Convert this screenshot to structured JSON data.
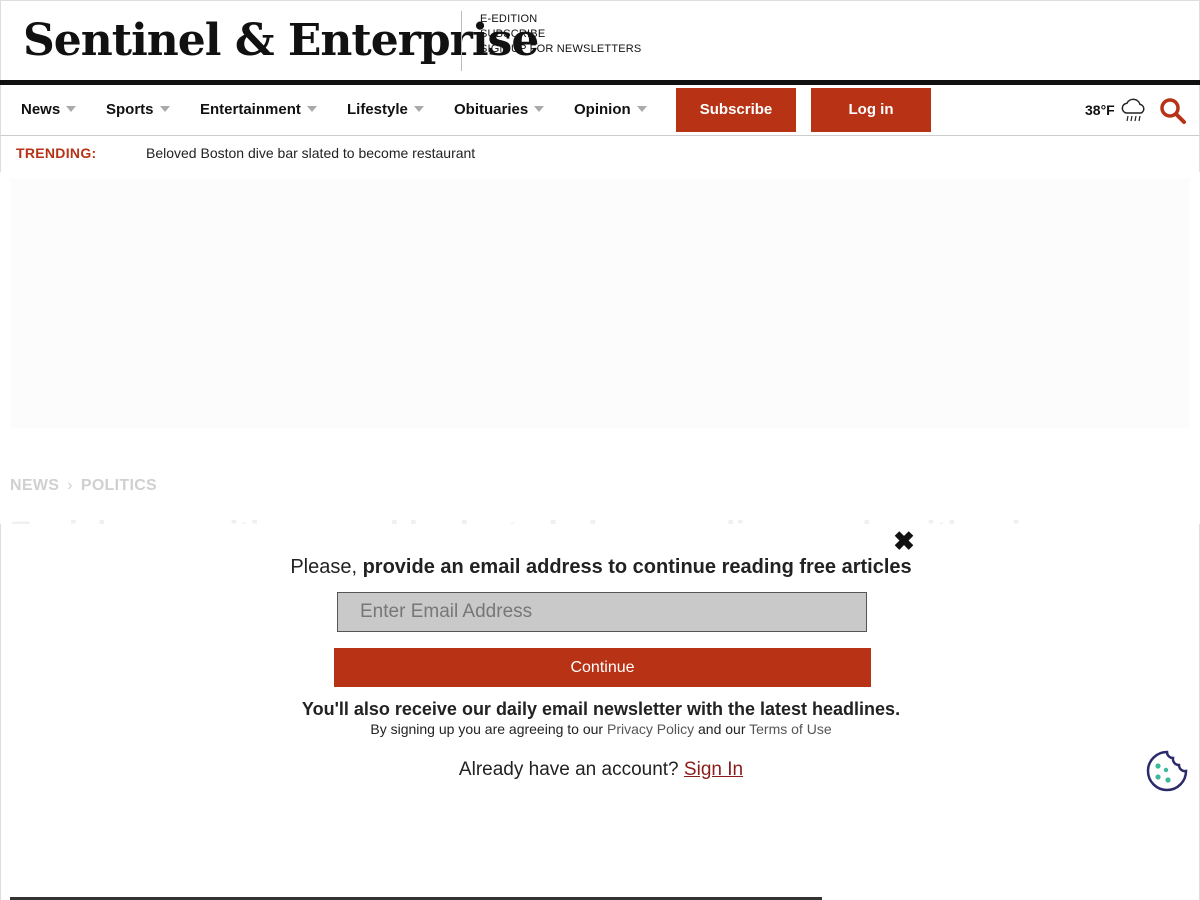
{
  "header": {
    "logo_text": "Sentinel & Enterprise",
    "top_links": [
      "E-EDITION",
      "SUBSCRIBE",
      "SIGN UP FOR NEWSLETTERS"
    ]
  },
  "nav": {
    "items": [
      "News",
      "Sports",
      "Entertainment",
      "Lifestyle",
      "Obituaries",
      "Opinion"
    ],
    "subscribe_label": "Subscribe",
    "login_label": "Log in",
    "temperature": "38°F",
    "weather_icon": "rain-cloud-icon",
    "search_icon": "search-icon"
  },
  "trending": {
    "label": "TRENDING:",
    "headline": "Beloved Boston dive bar slated to become restaurant"
  },
  "article": {
    "breadcrumb": [
      "NEWS",
      "POLITICS"
    ],
    "headline": "Facial recognition panel looks to balance police needs with privacy"
  },
  "modal": {
    "prompt_prefix": "Please, ",
    "prompt_bold": "provide an email address to continue reading free articles",
    "email_placeholder": "Enter Email Address",
    "continue_label": "Continue",
    "newsletter_note": "You'll also receive our daily email newsletter with the latest headlines.",
    "agree_prefix": "By signing up you are agreeing to our ",
    "privacy_link": "Privacy Policy",
    "agree_middle": " and our ",
    "terms_link": "Terms of Use",
    "already_text": "Already have an account? ",
    "signin_link": "Sign In"
  },
  "colors": {
    "brand_red": "#b83215",
    "signin_link": "#8b1c1c"
  }
}
